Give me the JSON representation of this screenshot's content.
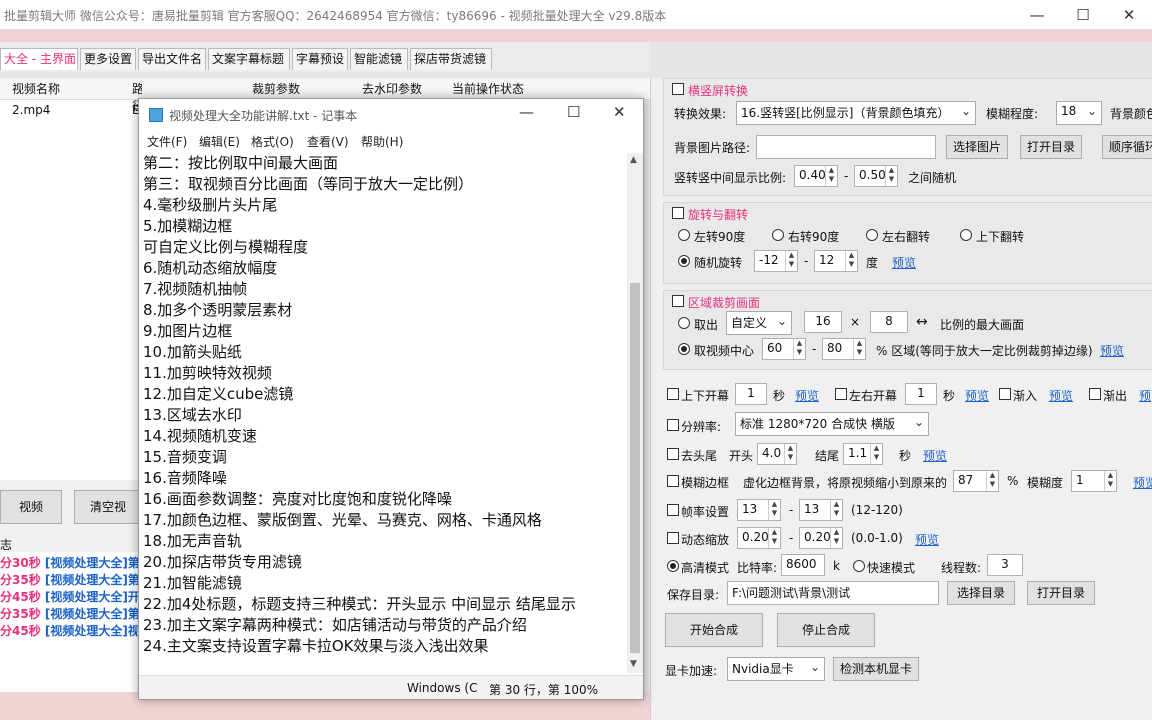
{
  "app": {
    "title": "批量剪辑大师  微信公众号：唐易批量剪辑  官方客服QQ：2642468954  官方微信：ty86696 - 视频批量处理大全  v29.8版本"
  },
  "tabs": [
    "大全 - 主界面",
    "更多设置",
    "导出文件名",
    "文案字幕标题",
    "字幕预设",
    "智能滤镜",
    "探店带货滤镜"
  ],
  "table": {
    "headers": [
      "视频名称",
      "路径",
      "裁剪参数",
      "去水印参数",
      "当前操作状态"
    ],
    "rows": [
      [
        "2.mp4",
        "E",
        "",
        "",
        ""
      ]
    ]
  },
  "left_buttons": {
    "video": "视频",
    "clear": "清空视"
  },
  "log": {
    "label": "志",
    "entries": [
      {
        "time": "分30秒",
        "text": "[视频处理大全]第"
      },
      {
        "time": "分35秒",
        "text": "[视频处理大全]第"
      },
      {
        "time": "分45秒",
        "text": "[视频处理大全]开"
      },
      {
        "time": "分35秒",
        "text": "[视频处理大全]第"
      },
      {
        "time": "分45秒",
        "text": "[视频处理大全]视"
      }
    ]
  },
  "notepad": {
    "title": "视频处理大全功能讲解.txt - 记事本",
    "menu": [
      "文件(F)",
      "编辑(E)",
      "格式(O)",
      "查看(V)",
      "帮助(H)"
    ],
    "lines": [
      "第二：按比例取中间最大画面",
      "第三：取视频百分比画面（等同于放大一定比例）",
      "4.毫秒级删片头片尾",
      "5.加模糊边框",
      "可自定义比例与模糊程度",
      "6.随机动态缩放幅度",
      "7.视频随机抽帧",
      "8.加多个透明蒙层素材",
      "9.加图片边框",
      "10.加箭头贴纸",
      "11.加剪映特效视频",
      "12.加自定义cube滤镜",
      "13.区域去水印",
      "14.视频随机变速",
      "15.音频变调",
      "16.音频降噪",
      "16.画面参数调整：亮度对比度饱和度锐化降噪",
      "17.加颜色边框、蒙版倒置、光晕、马赛克、网格、卡通风格",
      "18.加无声音轨",
      "20.加探店带货专用滤镜",
      "21.加智能滤镜",
      "22.加4处标题，标题支持三种模式：开头显示 中间显示 结尾显示",
      "23.加主文案字幕两种模式：如店铺活动与带货的产品介绍",
      "24.主文案支持设置字幕卡拉OK效果与淡入浅出效果"
    ],
    "status_encoding": "Windows (C",
    "status_pos": "第 30 行，第 100%"
  },
  "rotate_screen": {
    "title": "横竖屏转换",
    "effect_label": "转换效果:",
    "effect_value": "16.竖转竖[比例显示]（背景颜色填充）",
    "blur_label": "模糊程度:",
    "blur_value": "18",
    "bg_color_label": "背景颜色",
    "bg_path_label": "背景图片路径:",
    "bg_path_value": "",
    "choose_image": "选择图片",
    "open_dir": "打开目录",
    "order_loop": "顺序循环",
    "ratio_label": "竖转竖中间显示比例:",
    "ratio_min": "0.40",
    "ratio_max": "0.50",
    "ratio_suffix": "之间随机"
  },
  "rotate_flip": {
    "title": "旋转与翻转",
    "options": [
      "左转90度",
      "右转90度",
      "左右翻转",
      "上下翻转"
    ],
    "random_label": "随机旋转",
    "random_min": "-12",
    "random_max": "12",
    "unit": "度",
    "preview": "预览"
  },
  "crop": {
    "title": "区域裁剪画面",
    "take_label": "取出",
    "mode_value": "自定义",
    "w": "16",
    "h": "8",
    "ratio_text": "比例的最大画面",
    "center_label": "取视频中心",
    "c_min": "60",
    "c_max": "80",
    "center_suffix": "% 区域(等同于放大一定比例裁剪掉边缘)",
    "preview": "预览"
  },
  "options": {
    "fade_top": "上下开幕",
    "fade_top_val": "1",
    "sec": "秒",
    "preview": "预览",
    "fade_lr": "左右开幕",
    "fade_lr_val": "1",
    "fade_in": "渐入",
    "fade_out": "渐出",
    "preview_short": "预",
    "resolution_label": "分辨率:",
    "resolution_value": "标准 1280*720 合成快 横版",
    "trim_label": "去头尾",
    "trim_head": "开头",
    "trim_head_val": "4.0",
    "trim_tail": "结尾",
    "trim_tail_val": "1.1",
    "blur_border": "模糊边框",
    "blur_border_desc": "虚化边框背景，将原视频缩小到原来的",
    "blur_pct": "87",
    "pct": "%",
    "blur_degree": "模糊度",
    "blur_degree_val": "1",
    "fps_label": "帧率设置",
    "fps_min": "13",
    "fps_max": "13",
    "fps_range": "(12-120)",
    "zoom_label": "动态缩放",
    "zoom_min": "0.20",
    "zoom_max": "0.20",
    "zoom_range": "(0.0-1.0)",
    "hq_label": "高清模式",
    "bitrate_label": "比特率:",
    "bitrate_val": "8600",
    "k": "k",
    "fast_label": "快速模式",
    "threads_label": "线程数:",
    "threads_val": "3",
    "save_dir_label": "保存目录:",
    "save_dir_val": "F:\\问题测试\\背景\\测试",
    "choose_dir": "选择目录",
    "open_dir": "打开目录",
    "start": "开始合成",
    "stop": "停止合成",
    "gpu_label": "显卡加速:",
    "gpu_value": "Nvidia显卡",
    "detect_gpu": "检测本机显卡"
  },
  "colors": {
    "accent": "#e6327c",
    "link": "#1a62c8"
  }
}
